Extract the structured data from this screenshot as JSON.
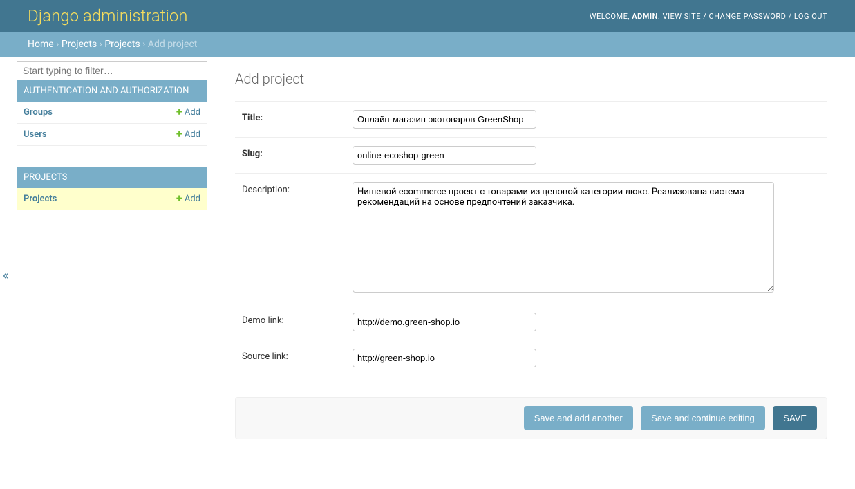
{
  "header": {
    "title": "Django administration",
    "welcome": "WELCOME,",
    "user": "ADMIN",
    "view_site": "VIEW SITE",
    "change_password": "CHANGE PASSWORD",
    "logout": "LOG OUT",
    "sep": " / "
  },
  "breadcrumbs": {
    "home": "Home",
    "app": "Projects",
    "model": "Projects",
    "current": "Add project",
    "sep": " › "
  },
  "sidebar": {
    "filter_placeholder": "Start typing to filter…",
    "apps": [
      {
        "label": "AUTHENTICATION AND AUTHORIZATION",
        "models": [
          {
            "name": "Groups",
            "add": "Add",
            "current": false
          },
          {
            "name": "Users",
            "add": "Add",
            "current": false
          }
        ]
      },
      {
        "label": "PROJECTS",
        "models": [
          {
            "name": "Projects",
            "add": "Add",
            "current": true
          }
        ]
      }
    ]
  },
  "content": {
    "heading": "Add project",
    "fields": {
      "title": {
        "label": "Title:",
        "value": "Онлайн-магазин экотоваров GreenShop",
        "required": true
      },
      "slug": {
        "label": "Slug:",
        "value": "online-ecoshop-green",
        "required": true
      },
      "description": {
        "label": "Description:",
        "value": "Нишевой ecommerce проект с товарами из ценовой категории люкс. Реализована система рекомендаций на основе предпочтений заказчика.",
        "required": false
      },
      "demo_link": {
        "label": "Demo link:",
        "value": "http://demo.green-shop.io",
        "required": false
      },
      "source_link": {
        "label": "Source link:",
        "value": "http://green-shop.io",
        "required": false
      }
    },
    "buttons": {
      "save_add_another": "Save and add another",
      "save_continue": "Save and continue editing",
      "save": "SAVE"
    }
  }
}
